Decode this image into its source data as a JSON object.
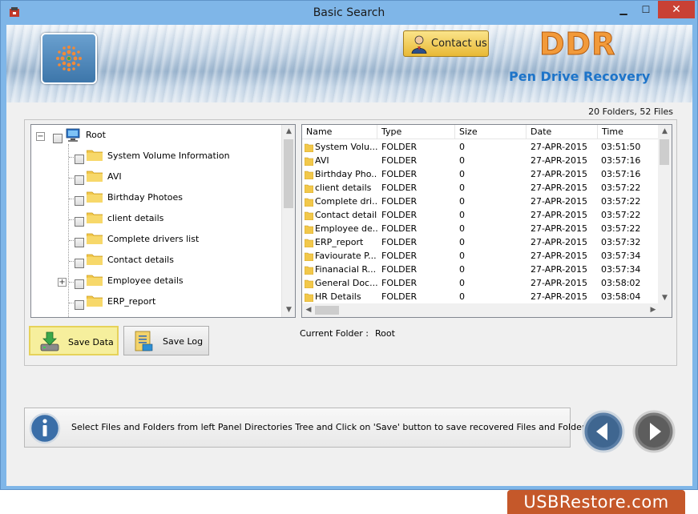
{
  "window": {
    "title": "Basic Search",
    "minimize_glyph": "▁",
    "maximize_glyph": "☐",
    "close_glyph": "✕"
  },
  "banner": {
    "contact_label": "Contact us",
    "brand": "DDR",
    "product": "Pen Drive Recovery"
  },
  "summary": "20 Folders, 52 Files",
  "tree": {
    "root_label": "Root",
    "items": [
      {
        "label": "System Volume Information",
        "expandable": false
      },
      {
        "label": "AVI",
        "expandable": false
      },
      {
        "label": "Birthday Photoes",
        "expandable": false
      },
      {
        "label": "client details",
        "expandable": false
      },
      {
        "label": "Complete drivers list",
        "expandable": false
      },
      {
        "label": "Contact details",
        "expandable": false
      },
      {
        "label": "Employee details",
        "expandable": true
      },
      {
        "label": "ERP_report",
        "expandable": false
      }
    ]
  },
  "list": {
    "columns": [
      "Name",
      "Type",
      "Size",
      "Date",
      "Time"
    ],
    "rows": [
      {
        "name": "System Volu...",
        "type": "FOLDER",
        "size": "0",
        "date": "27-APR-2015",
        "time": "03:51:50"
      },
      {
        "name": "AVI",
        "type": "FOLDER",
        "size": "0",
        "date": "27-APR-2015",
        "time": "03:57:16"
      },
      {
        "name": "Birthday Pho...",
        "type": "FOLDER",
        "size": "0",
        "date": "27-APR-2015",
        "time": "03:57:16"
      },
      {
        "name": "client details",
        "type": "FOLDER",
        "size": "0",
        "date": "27-APR-2015",
        "time": "03:57:22"
      },
      {
        "name": "Complete dri...",
        "type": "FOLDER",
        "size": "0",
        "date": "27-APR-2015",
        "time": "03:57:22"
      },
      {
        "name": "Contact details",
        "type": "FOLDER",
        "size": "0",
        "date": "27-APR-2015",
        "time": "03:57:22"
      },
      {
        "name": "Employee de...",
        "type": "FOLDER",
        "size": "0",
        "date": "27-APR-2015",
        "time": "03:57:22"
      },
      {
        "name": "ERP_report",
        "type": "FOLDER",
        "size": "0",
        "date": "27-APR-2015",
        "time": "03:57:32"
      },
      {
        "name": "Faviourate P...",
        "type": "FOLDER",
        "size": "0",
        "date": "27-APR-2015",
        "time": "03:57:34"
      },
      {
        "name": "Finanacial R...",
        "type": "FOLDER",
        "size": "0",
        "date": "27-APR-2015",
        "time": "03:57:34"
      },
      {
        "name": "General Doc...",
        "type": "FOLDER",
        "size": "0",
        "date": "27-APR-2015",
        "time": "03:58:02"
      },
      {
        "name": "HR Details",
        "type": "FOLDER",
        "size": "0",
        "date": "27-APR-2015",
        "time": "03:58:04"
      }
    ]
  },
  "buttons": {
    "save_data": "Save Data",
    "save_log": "Save Log"
  },
  "current_folder": {
    "label": "Current Folder :",
    "value": "Root"
  },
  "status": {
    "message": "Select Files and Folders from left Panel Directories Tree and Click on 'Save' button to save recovered Files and Folders."
  },
  "watermark": "USBRestore.com",
  "colors": {
    "brand_orange": "#f29a3a",
    "product_blue": "#1d74c9",
    "close_red": "#c94135",
    "highlight_yellow": "#f6ef9d"
  }
}
